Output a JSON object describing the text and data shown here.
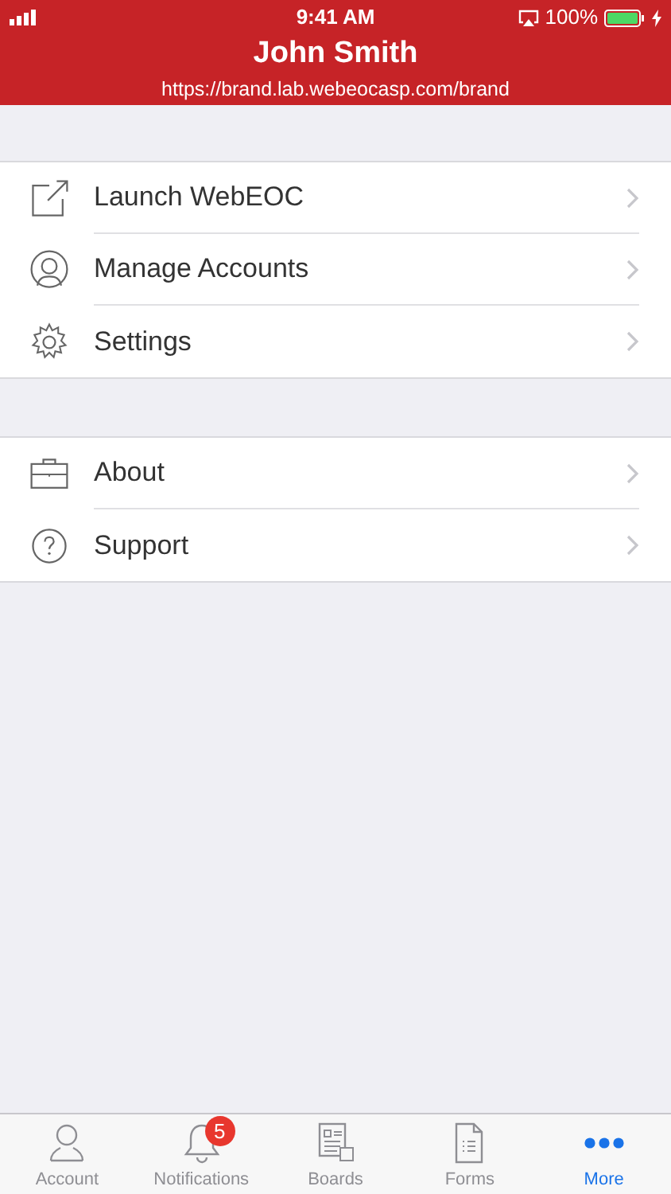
{
  "status_bar": {
    "time": "9:41 AM",
    "battery": "100%"
  },
  "header": {
    "title": "John Smith",
    "subtitle": "https://brand.lab.webeocasp.com/brand"
  },
  "sections": [
    {
      "items": [
        {
          "label": "Launch WebEOC"
        },
        {
          "label": "Manage Accounts"
        },
        {
          "label": "Settings"
        }
      ]
    },
    {
      "items": [
        {
          "label": "About"
        },
        {
          "label": "Support"
        }
      ]
    }
  ],
  "tabs": [
    {
      "label": "Account",
      "selected": false
    },
    {
      "label": "Notifications",
      "selected": false,
      "badge": "5"
    },
    {
      "label": "Boards",
      "selected": false
    },
    {
      "label": "Forms",
      "selected": false
    },
    {
      "label": "More",
      "selected": true
    }
  ]
}
